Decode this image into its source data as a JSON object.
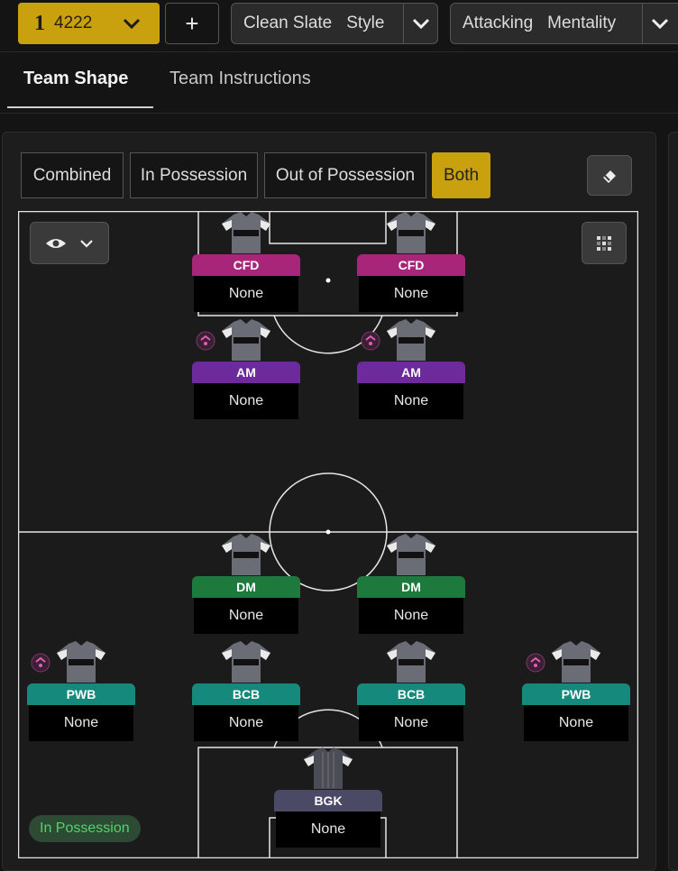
{
  "topbar": {
    "formation_number": "1",
    "formation_name": "4222",
    "add_label": "+",
    "style": {
      "label_a": "Clean Slate",
      "label_b": "Style"
    },
    "mentality": {
      "label_a": "Attacking",
      "label_b": "Mentality"
    }
  },
  "tabs": [
    {
      "label": "Team Shape",
      "active": true
    },
    {
      "label": "Team Instructions",
      "active": false
    }
  ],
  "filters": [
    {
      "label": "Combined",
      "active": false
    },
    {
      "label": "In Possession",
      "active": false
    },
    {
      "label": "Out of Possession",
      "active": false
    },
    {
      "label": "Both",
      "active": true
    }
  ],
  "players": [
    {
      "role": "CFD",
      "duty": "None",
      "color": "#a8267a",
      "badge": false
    },
    {
      "role": "CFD",
      "duty": "None",
      "color": "#a8267a",
      "badge": false
    },
    {
      "role": "AM",
      "duty": "None",
      "color": "#6d2a9a",
      "badge": true
    },
    {
      "role": "AM",
      "duty": "None",
      "color": "#6d2a9a",
      "badge": true
    },
    {
      "role": "DM",
      "duty": "None",
      "color": "#1d7a3c",
      "badge": false
    },
    {
      "role": "DM",
      "duty": "None",
      "color": "#1d7a3c",
      "badge": false
    },
    {
      "role": "PWB",
      "duty": "None",
      "color": "#15897c",
      "badge": true
    },
    {
      "role": "BCB",
      "duty": "None",
      "color": "#15897c",
      "badge": false
    },
    {
      "role": "BCB",
      "duty": "None",
      "color": "#15897c",
      "badge": false
    },
    {
      "role": "PWB",
      "duty": "None",
      "color": "#15897c",
      "badge": true
    },
    {
      "role": "BGK",
      "duty": "None",
      "color": "#4a4a66",
      "badge": false
    }
  ],
  "status_pill": "In Possession",
  "colors": {
    "accent": "#c9a00e",
    "status_green": "#55d36c"
  }
}
